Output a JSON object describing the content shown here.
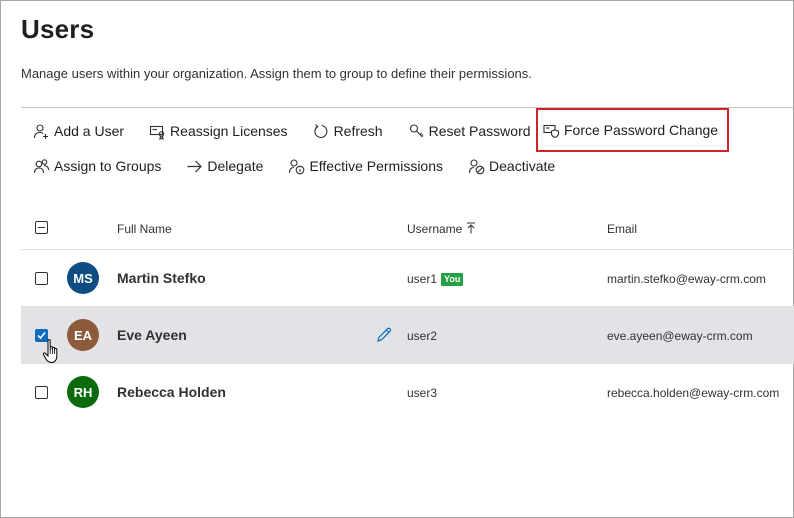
{
  "page": {
    "title": "Users",
    "subtitle": "Manage users within your organization. Assign them to group to define their permissions."
  },
  "toolbar": {
    "add_user": "Add a User",
    "reassign_licenses": "Reassign Licenses",
    "refresh": "Refresh",
    "reset_password": "Reset Password",
    "force_password_change": "Force Password Change",
    "assign_to_groups": "Assign to Groups",
    "delegate": "Delegate",
    "effective_permissions": "Effective Permissions",
    "deactivate": "Deactivate"
  },
  "table": {
    "columns": {
      "full_name": "Full Name",
      "username": "Username",
      "email": "Email"
    },
    "rows": [
      {
        "initials": "MS",
        "name": "Martin Stefko",
        "username": "user1",
        "badge": "You",
        "email": "martin.stefko@eway-crm.com",
        "avatar_color": "#0f4c81",
        "checked": false
      },
      {
        "initials": "EA",
        "name": "Eve Ayeen",
        "username": "user2",
        "badge": "",
        "email": "eve.ayeen@eway-crm.com",
        "avatar_color": "#8e5a3c",
        "checked": true
      },
      {
        "initials": "RH",
        "name": "Rebecca Holden",
        "username": "user3",
        "badge": "",
        "email": "rebecca.holden@eway-crm.com",
        "avatar_color": "#0b6a0b",
        "checked": false
      }
    ]
  },
  "colors": {
    "accent": "#0f6cbd",
    "highlight_border": "#d1232a",
    "selected_row": "#e1e3e6",
    "badge_green": "#24a147"
  }
}
